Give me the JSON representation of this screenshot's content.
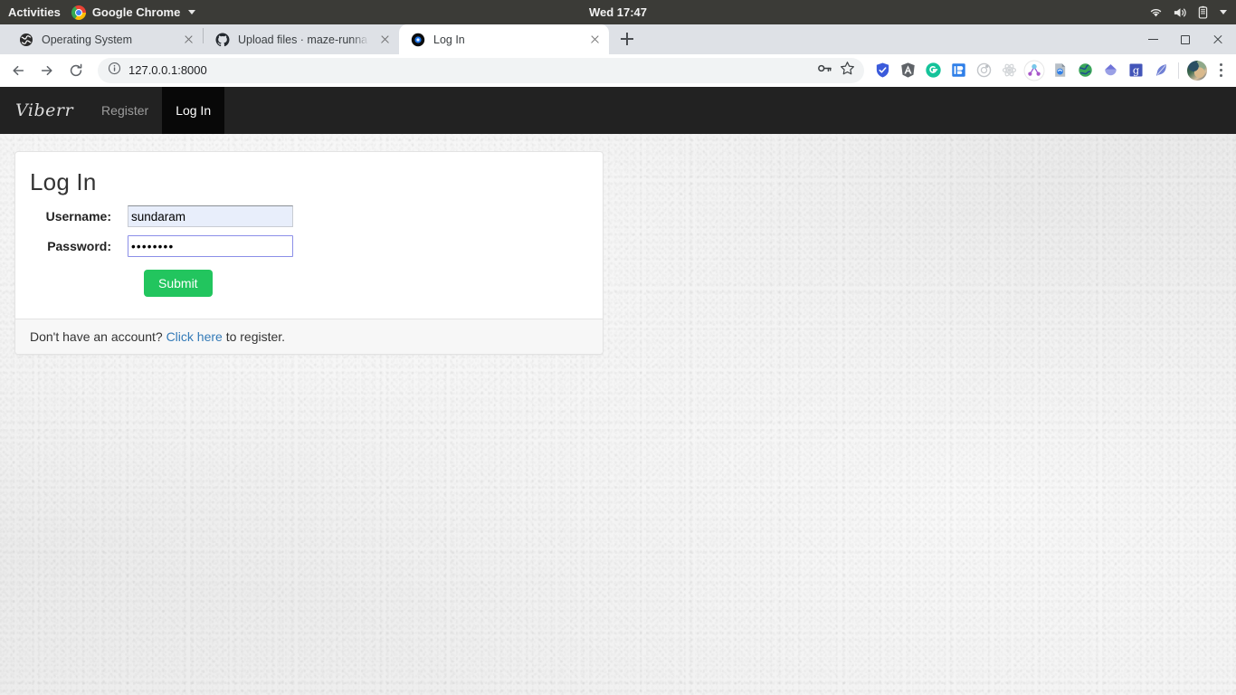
{
  "desktop": {
    "activities": "Activities",
    "app_menu": "Google Chrome",
    "clock": "Wed 17:47",
    "status_icons": [
      "wifi-icon",
      "volume-icon",
      "battery-icon",
      "chevron-down-icon"
    ]
  },
  "browser": {
    "tabs": [
      {
        "title": "Operating System",
        "favicon": "globe-icon",
        "active": false
      },
      {
        "title": "Upload files · maze-runna",
        "favicon": "github-icon",
        "active": false
      },
      {
        "title": "Log In",
        "favicon": "dark-circle-icon",
        "active": true
      }
    ],
    "new_tab_label": "+",
    "omnibox": {
      "url": "127.0.0.1:8000",
      "info_icon": "info-circle-icon",
      "key_icon": "password-key-icon",
      "star_icon": "bookmark-star-icon"
    },
    "nav": {
      "back": "back-arrow-icon",
      "forward": "forward-arrow-icon",
      "reload": "reload-icon"
    },
    "extensions": [
      "shield-blue-icon",
      "angular-icon",
      "grammarly-icon",
      "infinity-blue-icon",
      "orbit-gray-icon",
      "atom-gray-icon",
      "molecule-purple-icon",
      "pdf-tool-icon",
      "globe-green-icon",
      "gem-purple-icon",
      "google-translate-icon",
      "feather-icon"
    ],
    "profile": "avatar",
    "menu": "kebab-menu-icon",
    "window_controls": [
      "minimize",
      "maximize",
      "close"
    ]
  },
  "site": {
    "brand": "Viberr",
    "nav_links": [
      {
        "label": "Register",
        "active": false
      },
      {
        "label": "Log In",
        "active": true
      }
    ]
  },
  "login": {
    "title": "Log In",
    "username": {
      "label": "Username:",
      "value": "sundaram",
      "placeholder": ""
    },
    "password": {
      "label": "Password:",
      "value": "••••••••",
      "placeholder": ""
    },
    "submit_label": "Submit",
    "footer": {
      "prefix": "Don't have an account?",
      "link": "Click here",
      "suffix": "to register."
    }
  },
  "colors": {
    "navbar": "#222222",
    "navbar_active": "#080808",
    "submit_green": "#22c55e",
    "link_blue": "#337ab7",
    "autofill_blue": "#e8eefb",
    "focus_border": "#8b8fe8"
  }
}
